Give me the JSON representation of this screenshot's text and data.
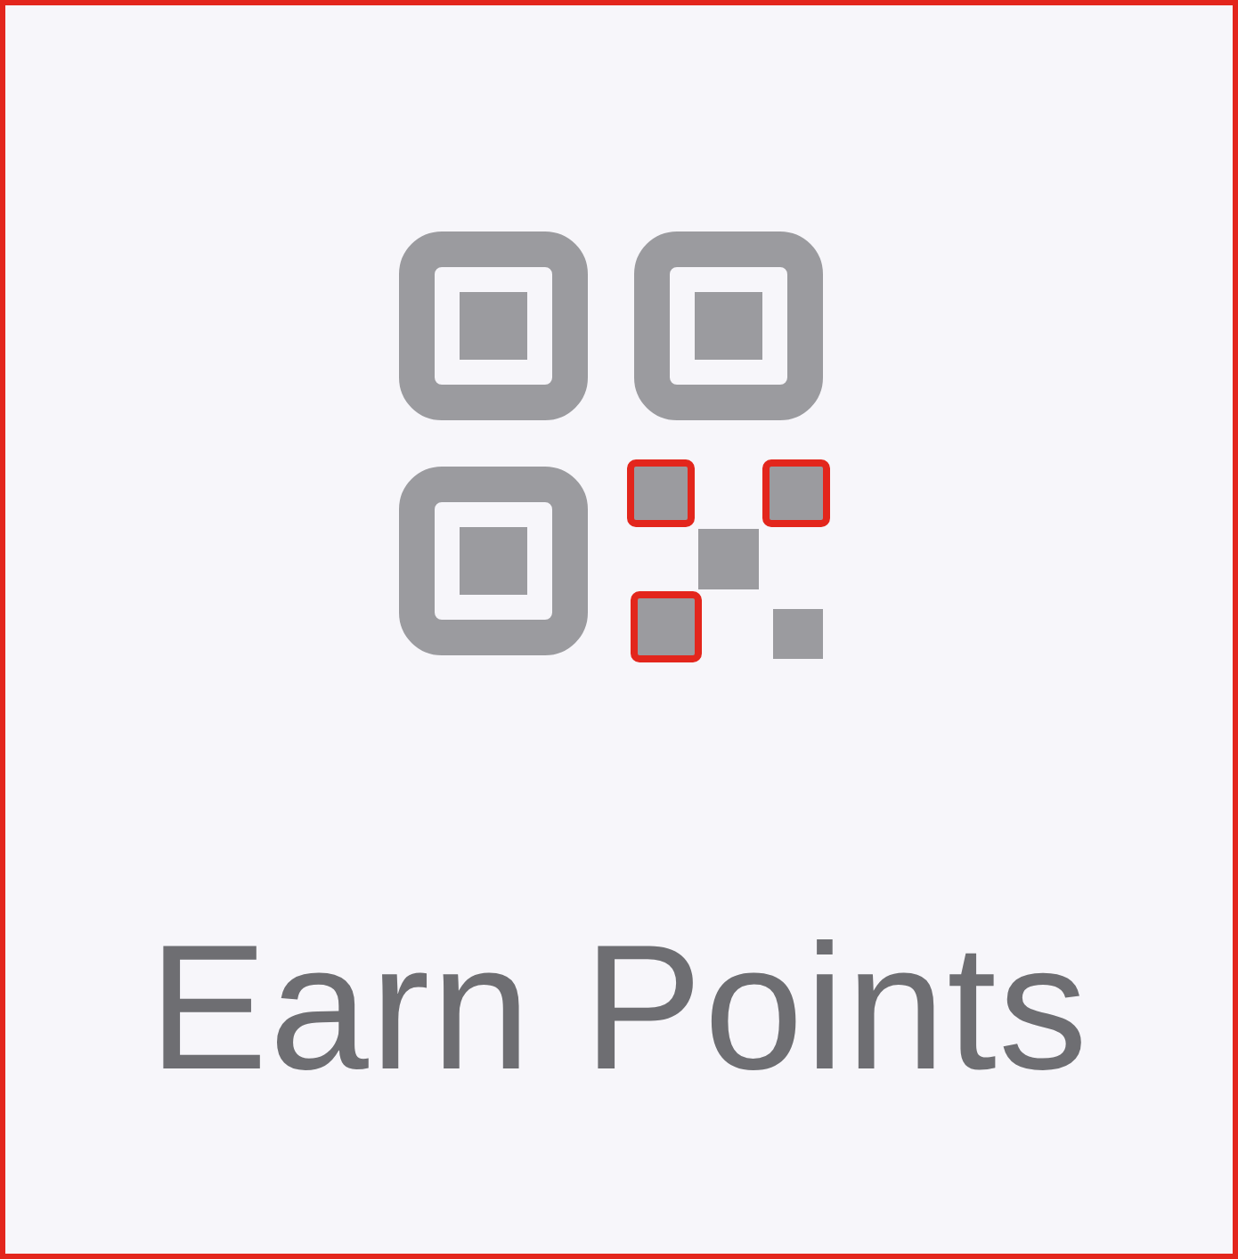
{
  "button": {
    "label": "Earn Points"
  }
}
